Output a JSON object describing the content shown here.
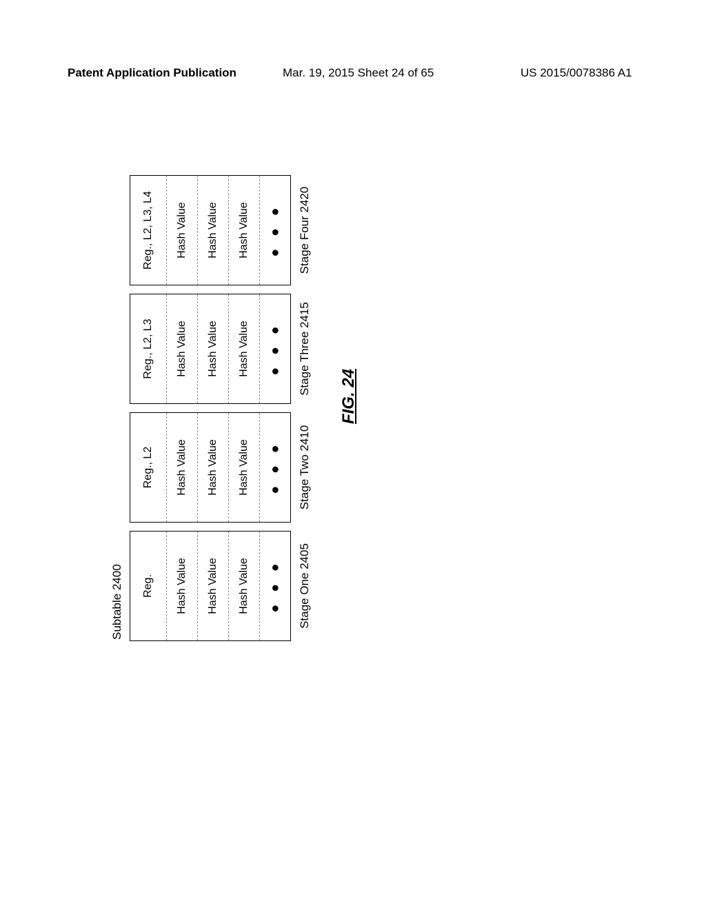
{
  "header": {
    "left": "Patent Application Publication",
    "center": "Mar. 19, 2015  Sheet 24 of 65",
    "right": "US 2015/0078386 A1"
  },
  "subtable_label": "Subtable 2400",
  "stages": [
    {
      "header": "Reg.",
      "rows": [
        "Hash Value",
        "Hash Value",
        "Hash Value"
      ],
      "caption": "Stage One  2405"
    },
    {
      "header": "Reg., L2",
      "rows": [
        "Hash Value",
        "Hash Value",
        "Hash Value"
      ],
      "caption": "Stage Two 2410"
    },
    {
      "header": "Reg., L2, L3",
      "rows": [
        "Hash Value",
        "Hash Value",
        "Hash Value"
      ],
      "caption": "Stage Three 2415"
    },
    {
      "header": "Reg., L2, L3, L4",
      "rows": [
        "Hash Value",
        "Hash Value",
        "Hash Value"
      ],
      "caption": "Stage Four 2420"
    }
  ],
  "dots": "● ● ●",
  "figure_caption": "FIG. 24"
}
